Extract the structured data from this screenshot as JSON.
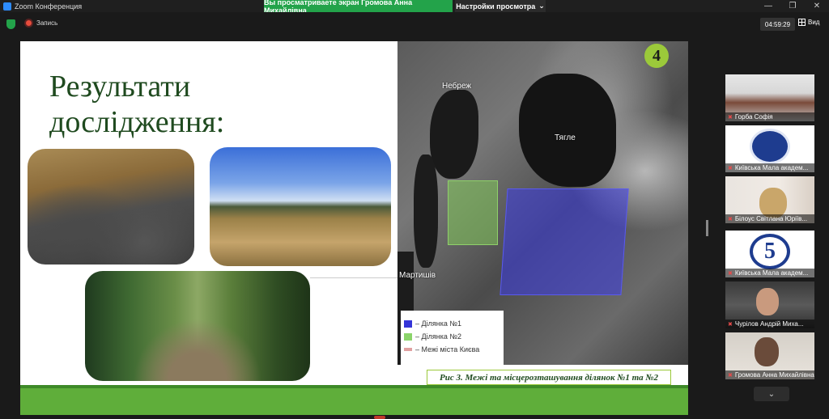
{
  "window": {
    "app_title": "Zoom Конференция",
    "share_banner": "Вы просматриваете экран Громова Анна Михайлівна",
    "view_options": "Настройки просмотра",
    "controls": [
      "—",
      "❐",
      "✕"
    ]
  },
  "toolbar": {
    "record_label": "Запись",
    "timer": "04:59:29",
    "view_label": "Вид"
  },
  "slide": {
    "title": "Результати дослідження:",
    "badge_number": "4",
    "map_labels": {
      "nebrezh": "Небреж",
      "tyagle": "Тягле",
      "martyshiv": "Мартишів"
    },
    "legend": [
      {
        "label": "– Ділянка №1",
        "color": "#3535d8"
      },
      {
        "label": "– Ділянка №2",
        "color": "#8bd46a"
      },
      {
        "label": "– Межі міста Києва",
        "color": "#e0a0a0"
      }
    ],
    "caption": "Рис 3. Межі та місцерозташування ділянок №1 та №2"
  },
  "participants": [
    {
      "name": "Горба Софія",
      "muted": true
    },
    {
      "name": "Київська Мала академ...",
      "muted": true
    },
    {
      "name": "Білоус Світлана Юріїв...",
      "muted": true
    },
    {
      "name": "Київська Мала академ...",
      "muted": true
    },
    {
      "name": "Чурілов Андрій Миха...",
      "muted": true
    },
    {
      "name": "Громова Анна Михайлівна",
      "muted": true
    }
  ],
  "colors": {
    "share_green": "#23a34a",
    "slide_green": "#5fae3a",
    "active_speaker": "#c6e63a"
  }
}
